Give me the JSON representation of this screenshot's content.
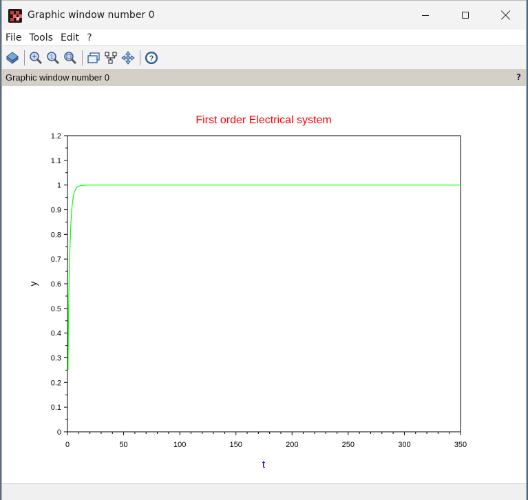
{
  "window": {
    "title": "Graphic window number 0",
    "minimize_icon": "minimize-icon",
    "maximize_icon": "maximize-icon",
    "close_icon": "close-icon"
  },
  "menubar": {
    "items": [
      {
        "label": "File"
      },
      {
        "label": "Tools"
      },
      {
        "label": "Edit"
      },
      {
        "label": "?"
      }
    ]
  },
  "toolbar": {
    "icons": [
      "2d-3d-rotate-icon",
      "zoom-icon",
      "unzoom-icon",
      "zoom-area-icon",
      "datatip-icon",
      "datatip-edit-icon",
      "pan-icon",
      "help-icon"
    ]
  },
  "infobar": {
    "text": "Graphic window number 0",
    "help": "?"
  },
  "colors": {
    "title": "#ff0000",
    "xlabel": "#0000ff",
    "ylabel": "#000000",
    "series": "#00ff00",
    "window_bg": "#f3f3f3",
    "infobar_bg": "#d4d0c8"
  },
  "chart_data": {
    "type": "line",
    "title": "First order Electrical system",
    "xlabel": "t",
    "ylabel": "y",
    "xlim": [
      0,
      350
    ],
    "ylim": [
      0,
      1.2
    ],
    "x_ticks": [
      "0",
      "50",
      "100",
      "150",
      "200",
      "250",
      "300",
      "350"
    ],
    "y_ticks": [
      "0",
      "0.1",
      "0.2",
      "0.3",
      "0.4",
      "0.5",
      "0.6",
      "0.7",
      "0.8",
      "0.9",
      "1",
      "1.1",
      "1.2"
    ],
    "grid": false,
    "series": [
      {
        "x": [
          0.5,
          1,
          1.5,
          2,
          3,
          4,
          5,
          6,
          8,
          10,
          12,
          15,
          20,
          25,
          30,
          50,
          100,
          150,
          200,
          250,
          300,
          350
        ],
        "y": [
          0.25,
          0.49,
          0.63,
          0.72,
          0.84,
          0.91,
          0.95,
          0.97,
          0.99,
          0.995,
          0.998,
          0.999,
          1.0,
          1.0,
          1.0,
          1.0,
          1.0,
          1.0,
          1.0,
          1.0,
          1.0,
          1.0
        ]
      }
    ]
  }
}
